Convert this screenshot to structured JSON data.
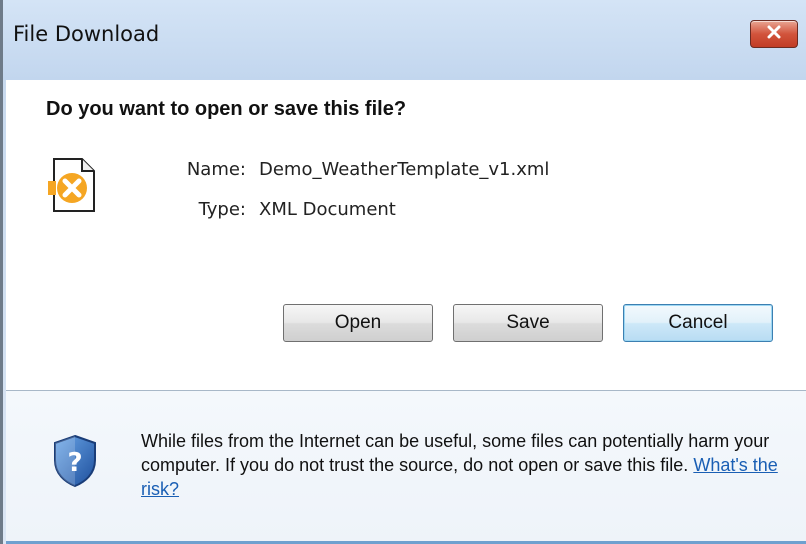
{
  "window": {
    "title": "File Download",
    "close_label": "Close"
  },
  "dialog": {
    "question": "Do you want to open or save this file?",
    "file": {
      "name_label": "Name:",
      "name_value": "Demo_WeatherTemplate_v1.xml",
      "type_label": "Type:",
      "type_value": "XML Document",
      "icon": "xml-file-icon"
    },
    "buttons": {
      "open": "Open",
      "save": "Save",
      "cancel": "Cancel"
    },
    "warning": {
      "icon": "shield-question-icon",
      "text": "While files from the Internet can be useful, some files can potentially harm your computer. If you do not trust the source, do not open or save this file.",
      "link_text": "What's the risk?"
    }
  },
  "colors": {
    "title_bar": "#c5d8ee",
    "close_button": "#d2543c",
    "link": "#1a5fb4",
    "default_button_border": "#3c7fb1"
  }
}
